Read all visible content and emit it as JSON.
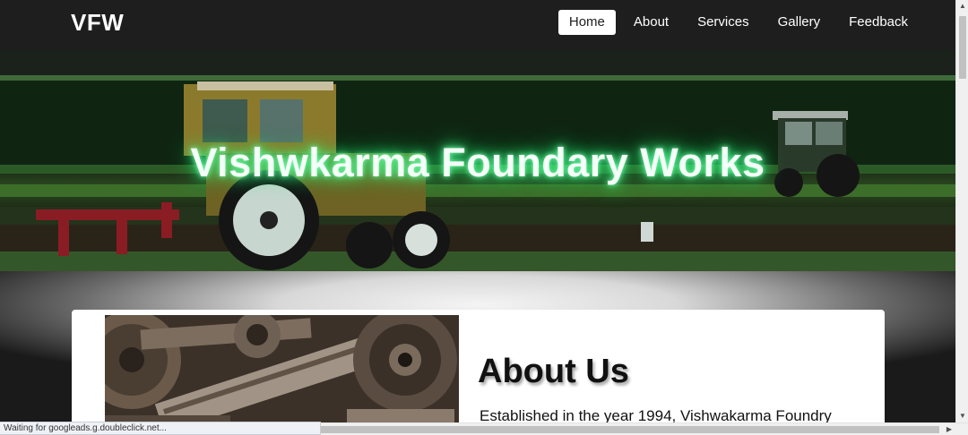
{
  "navbar": {
    "brand": "VFW",
    "links": [
      {
        "label": "Home",
        "active": true
      },
      {
        "label": "About",
        "active": false
      },
      {
        "label": "Services",
        "active": false
      },
      {
        "label": "Gallery",
        "active": false
      },
      {
        "label": "Feedback",
        "active": false
      }
    ]
  },
  "hero": {
    "title": "Vishwkarma Foundary Works"
  },
  "about": {
    "title": "About Us",
    "text": "Established in the year 1994, Vishwakarma Foundry"
  },
  "status_bar": {
    "text": "Waiting for googleads.g.doubleclick.net..."
  },
  "colors": {
    "navbar_bg": "#1e1e1e",
    "hero_glow": "#3cff8a"
  }
}
